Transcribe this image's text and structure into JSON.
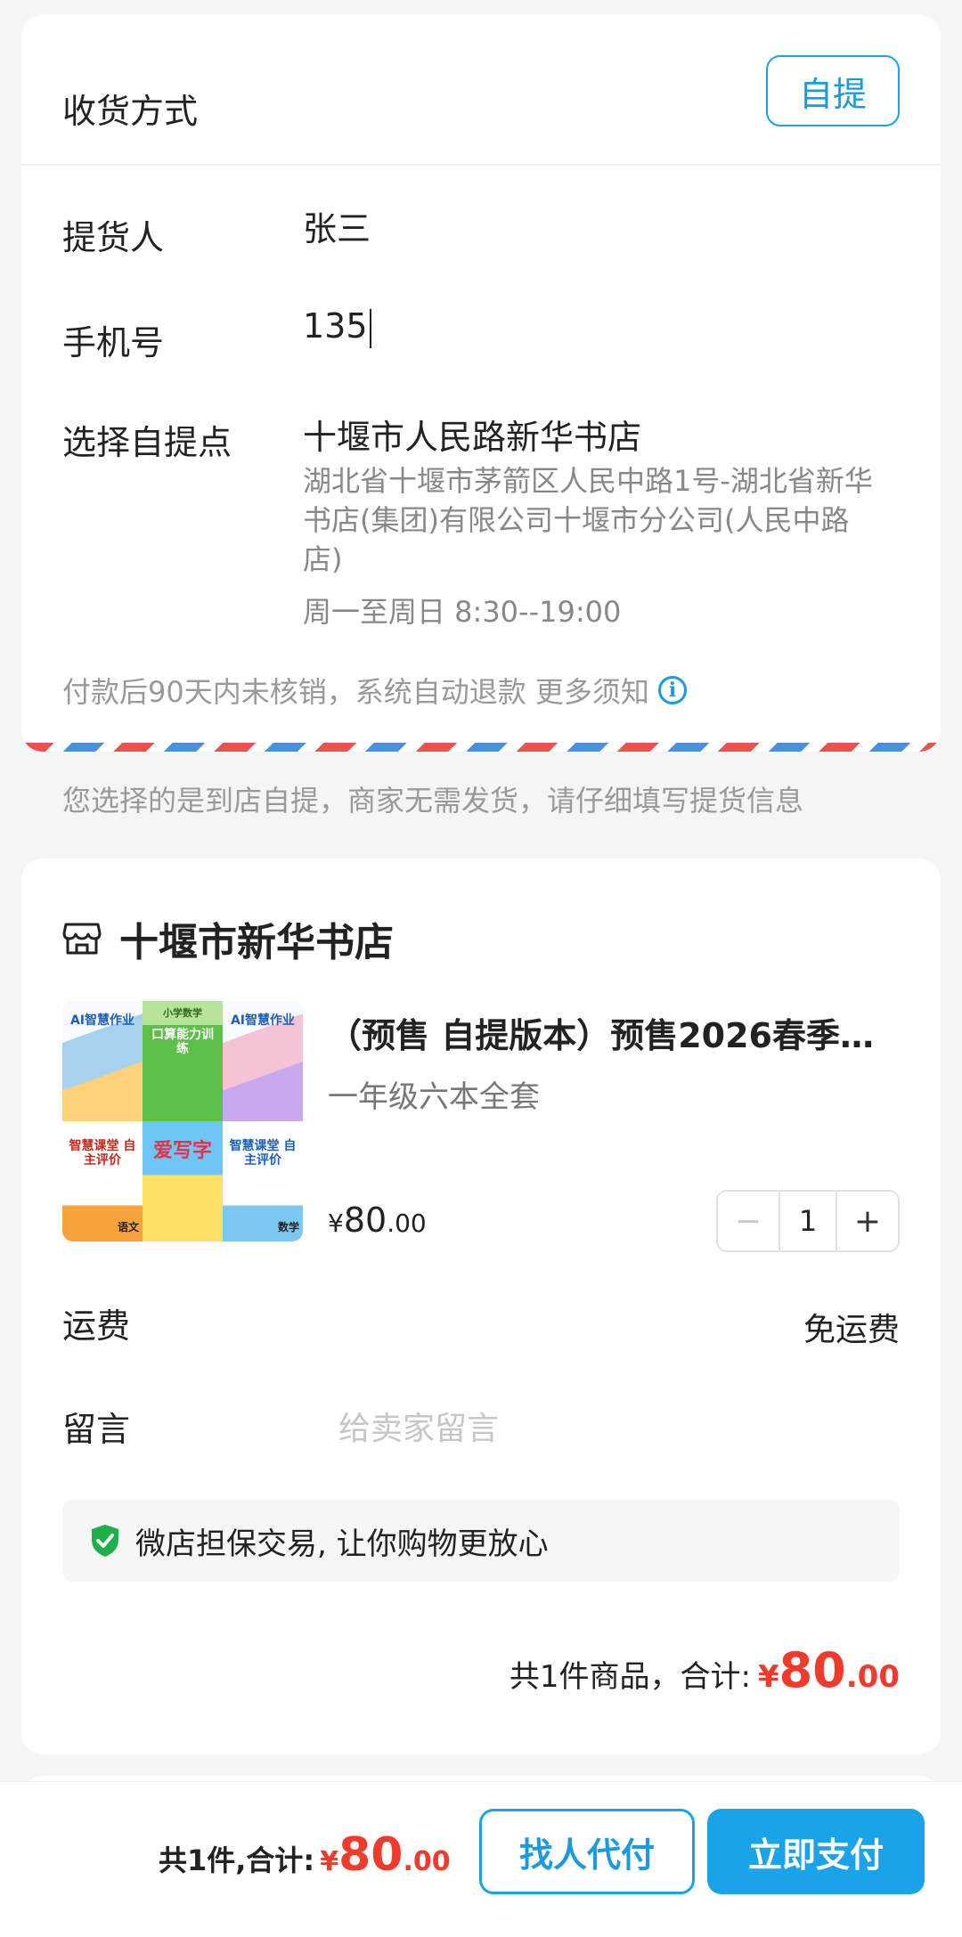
{
  "delivery": {
    "title": "收货方式",
    "mode_button": "自提",
    "pickup_person_label": "提货人",
    "pickup_person_value": "张三",
    "phone_label": "手机号",
    "phone_value": "135",
    "pickup_point_label": "选择自提点",
    "pickup_point_name": "十堰市人民路新华书店",
    "pickup_point_address": "湖北省十堰市茅箭区人民中路1号-湖北省新华书店(集团)有限公司十堰市分公司(人民中路店)",
    "pickup_point_hours": "周一至周日 8:30--19:00",
    "refund_note": "付款后90天内未核销，系统自动退款 更多须知"
  },
  "pickup_hint": "您选择的是到店自提，商家无需发货，请仔细填写提货信息",
  "shop": {
    "name": "十堰市新华书店",
    "product": {
      "title": "（预售 自提版本）预售2026春季…",
      "sku": "一年级六本全套",
      "price_currency": "¥",
      "price_int": "80",
      "price_dec": ".00",
      "quantity": "1",
      "minus": "−",
      "plus": "+",
      "cover_texts": {
        "b1": "AI智慧作业",
        "b2": "口算能力训练",
        "b3": "AI智慧作业",
        "b4": "智慧课堂 自主评价",
        "b5": "爱写字",
        "b6": "智慧课堂 自主评价",
        "b4_subject": "语文",
        "b6_subject": "数学",
        "b2_top": "小学数学"
      }
    },
    "shipping_label": "运费",
    "shipping_value": "免运费",
    "message_label": "留言",
    "message_placeholder": "给卖家留言",
    "guarantee_text": "微店担保交易, 让你购物更放心",
    "subtotal_label": "共1件商品，合计:",
    "subtotal_currency": "¥",
    "subtotal_int": "80",
    "subtotal_dec": ".00"
  },
  "bottom_bar": {
    "total_label": "共1件,合计:",
    "total_currency": "¥",
    "total_int": "80",
    "total_dec": ".00",
    "pay_for_me_button": "找人代付",
    "pay_now_button": "立即支付"
  },
  "colors": {
    "accent": "#1aa3e8",
    "price_red": "#ee3b2b",
    "guarantee_green": "#20b04b"
  }
}
